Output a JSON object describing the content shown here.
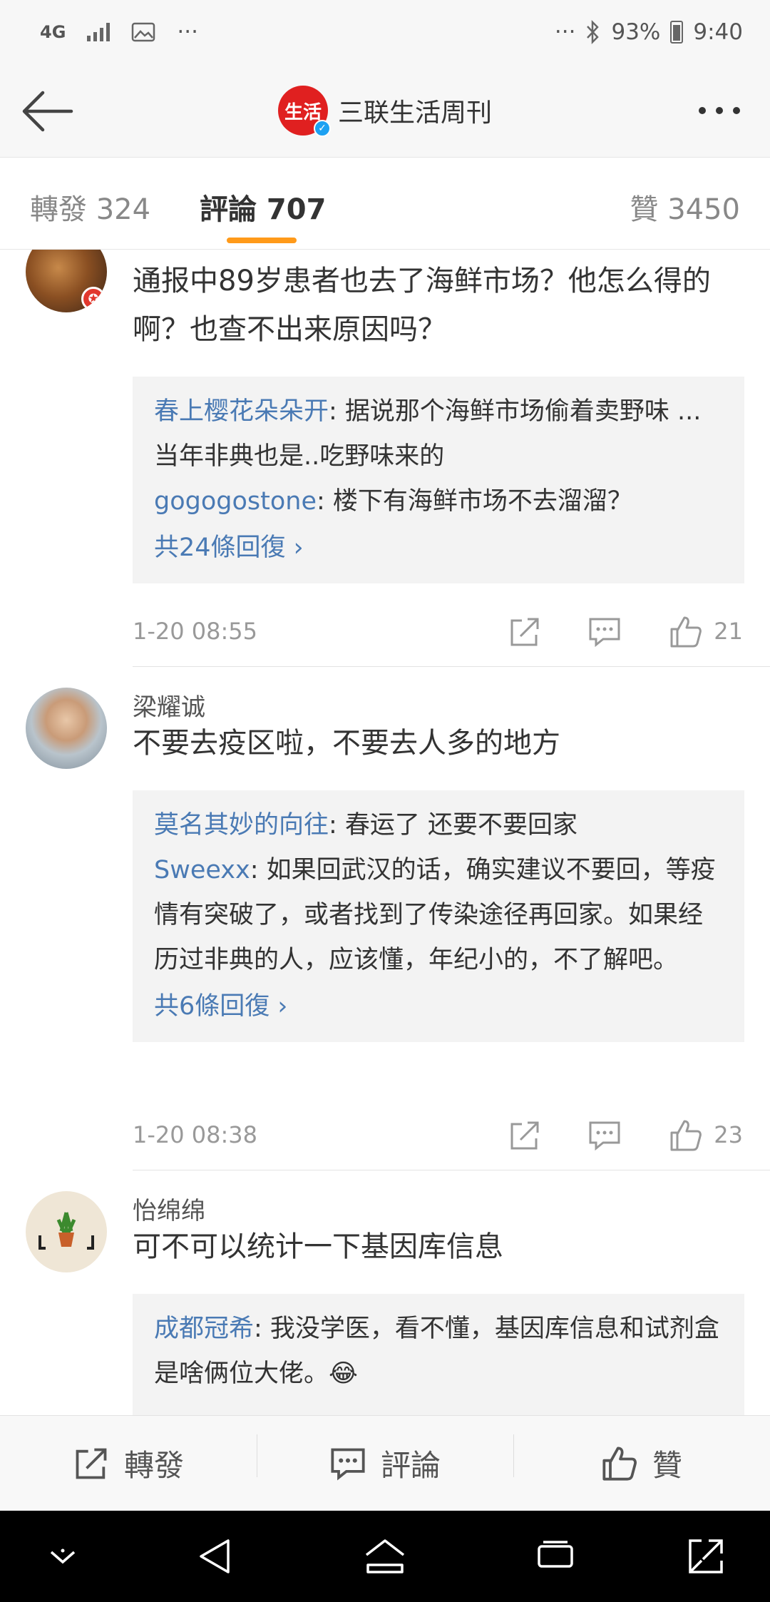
{
  "status_bar": {
    "network": "4G",
    "overflow": "···",
    "overflow_right": "···",
    "battery": "93%",
    "time": "9:40"
  },
  "header": {
    "logo_text": "生活",
    "title": "三联生活周刊"
  },
  "tabs": {
    "repost": "轉發 324",
    "comments": "評論 707",
    "likes": "贊 3450"
  },
  "comments": [
    {
      "text": "通报中89岁患者也去了海鲜市场？他怎么得的啊？也查不出来原因吗？",
      "replies": [
        {
          "name": "春上樱花朵朵开",
          "text": ": 据说那个海鲜市场偷着卖野味 ...当年非典也是..吃野味来的"
        },
        {
          "name": "gogogostone",
          "text": ": 楼下有海鲜市场不去溜溜？"
        }
      ],
      "more": "共24條回復 ›",
      "time": "1-20 08:55",
      "likes": "21"
    },
    {
      "user": "梁耀诚",
      "text": "不要去疫区啦，不要去人多的地方",
      "replies": [
        {
          "name": "莫名其妙的向往",
          "text": ": 春运了 还要不要回家"
        },
        {
          "name": "Sweexx",
          "text": ": 如果回武汉的话，确实建议不要回，等疫情有突破了，或者找到了传染途径再回家。如果经历过非典的人，应该懂，年纪小的，不了解吧。"
        }
      ],
      "more": "共6條回復 ›",
      "time": "1-20 08:38",
      "likes": "23"
    },
    {
      "user": "怡绵绵",
      "text": "可不可以统计一下基因库信息",
      "replies": [
        {
          "name": "成都冠希",
          "text": ": 我没学医，看不懂，基因库信息和试剂盒是啥俩位大佬。😂"
        }
      ]
    }
  ],
  "actions": {
    "repost": "轉發",
    "comment": "評論",
    "like": "贊"
  },
  "colors": {
    "accent": "#ff9a1a",
    "link": "#4a7ab4",
    "brand_red": "#e02020"
  }
}
